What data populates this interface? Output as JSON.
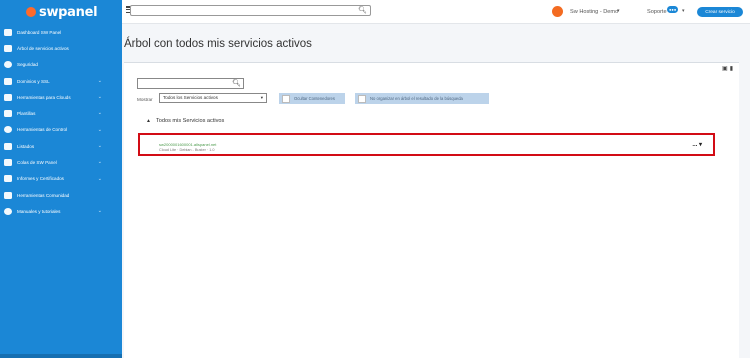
{
  "brand": {
    "name": "swpanel"
  },
  "sidebar": {
    "items": [
      {
        "label": "Dashboard SW Panel",
        "has_chevron": false
      },
      {
        "label": "Árbol de servicios activos",
        "has_chevron": false
      },
      {
        "label": "Seguridad",
        "has_chevron": false
      },
      {
        "label": "Dominios y SSL",
        "has_chevron": true
      },
      {
        "label": "Herramientas para Clouds",
        "has_chevron": true
      },
      {
        "label": "Plantillas",
        "has_chevron": true
      },
      {
        "label": "Herramientas de Control",
        "has_chevron": true
      },
      {
        "label": "Listados",
        "has_chevron": true
      },
      {
        "label": "Colas de SW Panel",
        "has_chevron": true
      },
      {
        "label": "Informes y Certificados",
        "has_chevron": true
      },
      {
        "label": "Herramientas Comunidad",
        "has_chevron": false
      },
      {
        "label": "Manuales y tutoriales",
        "has_chevron": true
      }
    ],
    "chevron_glyph": "⌄"
  },
  "topbar": {
    "search_placeholder": "",
    "account_label": "Sw Hosting - Demo",
    "support_label": "Soporte",
    "support_badge": "●●●",
    "create_button_label": "Crear servicio"
  },
  "page": {
    "title": "Árbol con todos mis servicios activos"
  },
  "panel": {
    "search_value": "",
    "mostrar_label": "Mostrar",
    "mostrar_selected": "Todos los Servicios activos",
    "toggle_containers_label": "Ocultar Contenedores",
    "toggle_no_tree_label": "No organizar en árbol el resultado de la búsqueda",
    "tree_root_label": "Todos mis Servicios activos",
    "service": {
      "domain": "sw2000001600001.allspanel.net",
      "meta": "Cloud Lite  ·  Debian - Buster  ·  1.0",
      "menu_label": "... ▾"
    }
  },
  "colors": {
    "sidebar_bg": "#1b87d6",
    "accent": "#1b87d6",
    "brand_orange": "#f36b21",
    "highlight_border": "#d20c15"
  }
}
